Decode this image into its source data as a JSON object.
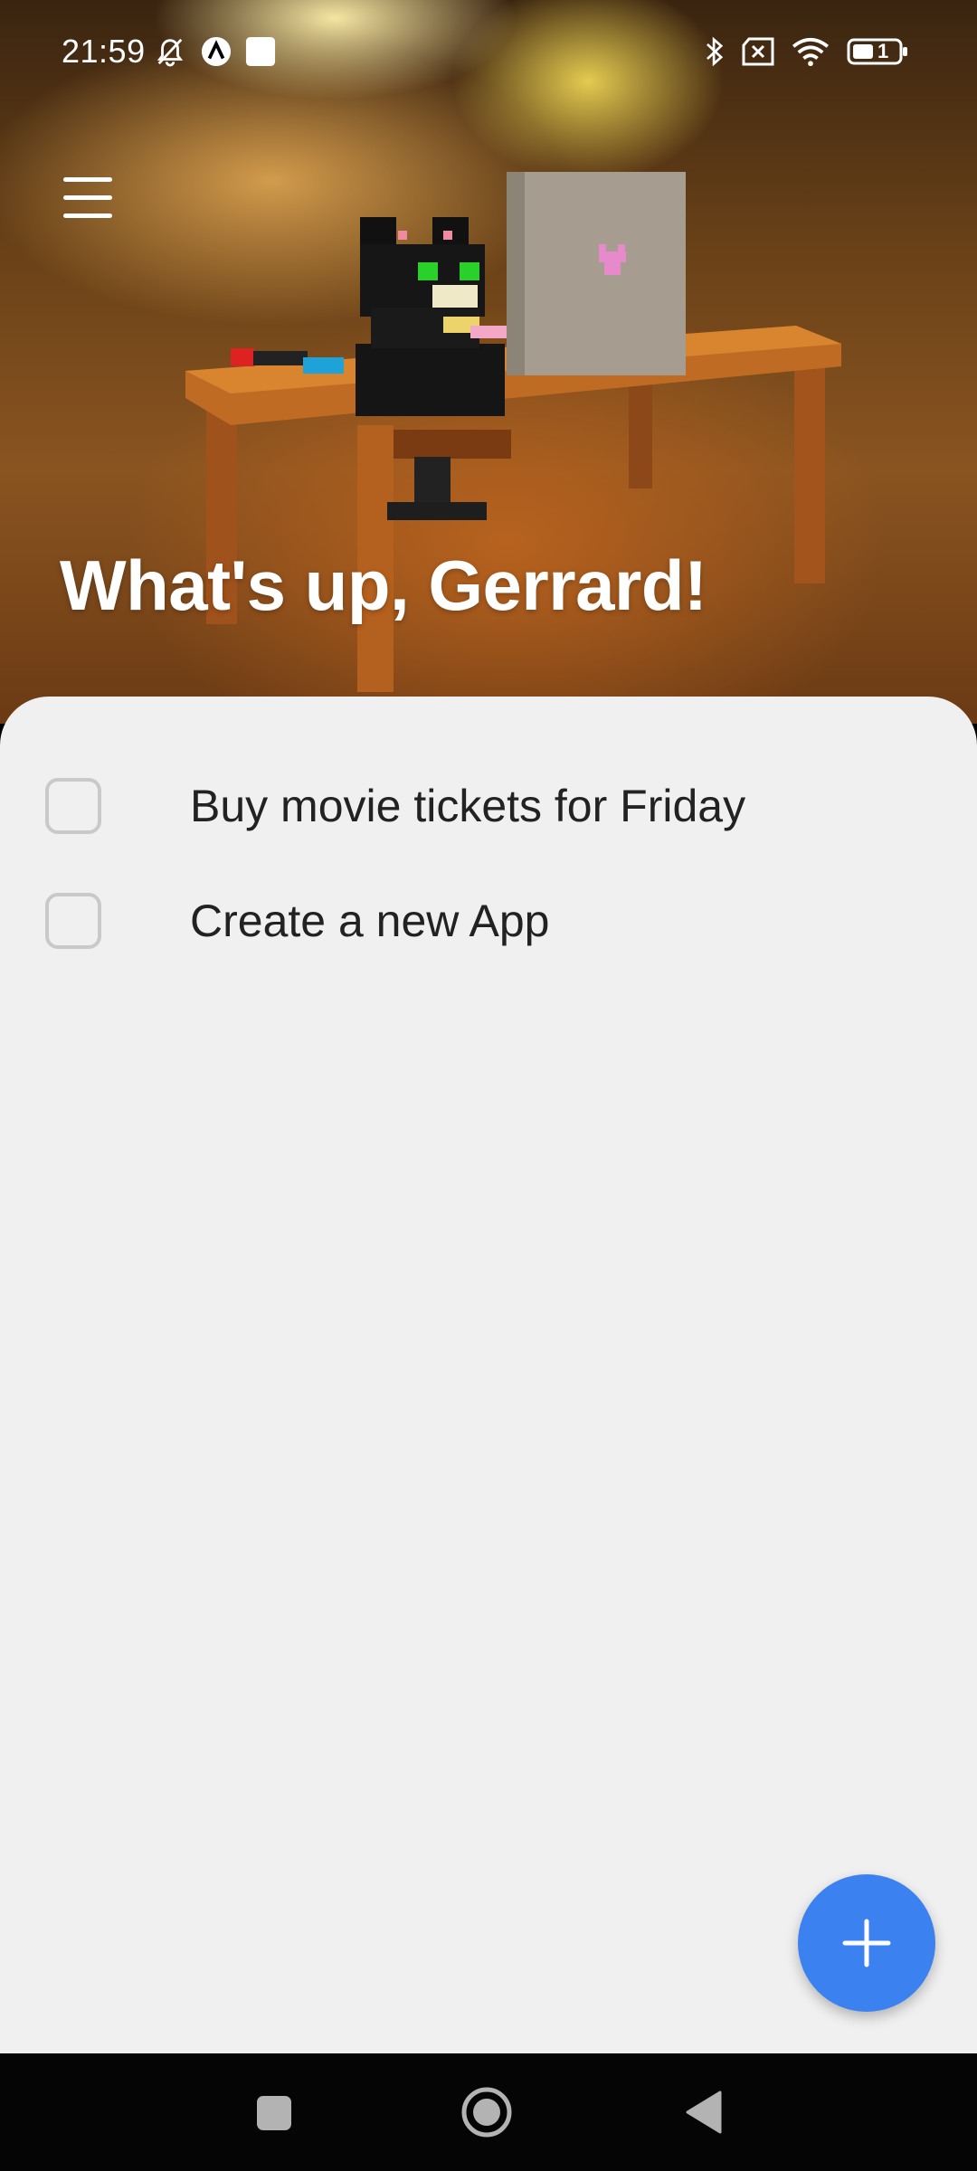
{
  "status_bar": {
    "time": "21:59",
    "left_icons": [
      "bell-off-icon",
      "app-a-icon",
      "notification-square-icon"
    ],
    "right_icons": [
      "bluetooth-icon",
      "no-sim-icon",
      "wifi-icon",
      "battery-icon"
    ],
    "battery_level": "1"
  },
  "header": {
    "menu_icon": "hamburger-menu-icon",
    "greeting": "What's up, Gerrard!"
  },
  "tasks": [
    {
      "label": "Buy movie tickets for Friday",
      "checked": false
    },
    {
      "label": "Create a new App",
      "checked": false
    }
  ],
  "fab": {
    "icon": "plus-icon",
    "color": "#3b82f0"
  },
  "nav_bar": {
    "buttons": [
      "recent-apps-icon",
      "home-icon",
      "back-icon"
    ]
  },
  "colors": {
    "sheet": "#f0f0f0",
    "accent": "#3b82f0",
    "nav": "#050505"
  }
}
